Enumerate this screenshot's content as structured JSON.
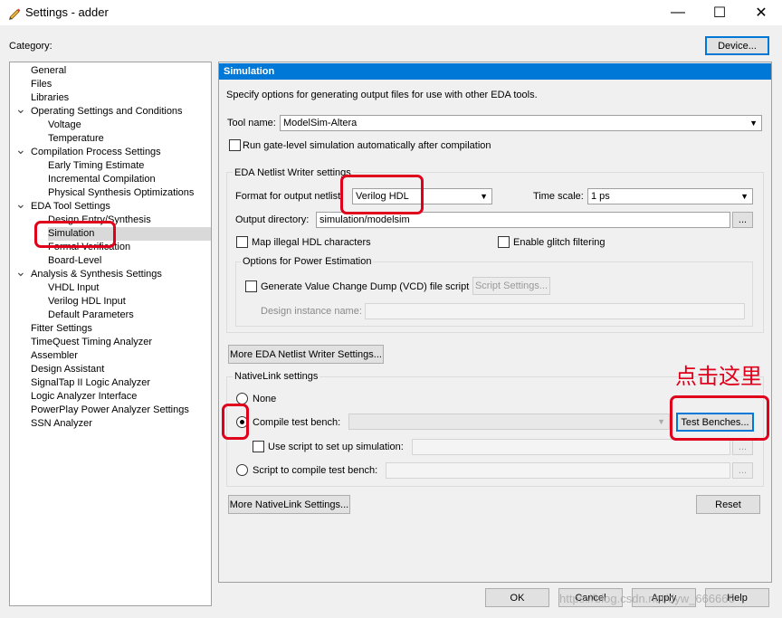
{
  "window": {
    "title": "Settings - adder",
    "icon": "pencil-icon"
  },
  "header": {
    "category_label": "Category:",
    "device_button": "Device..."
  },
  "tree": [
    {
      "label": "General",
      "level": 0
    },
    {
      "label": "Files",
      "level": 0
    },
    {
      "label": "Libraries",
      "level": 0
    },
    {
      "label": "Operating Settings and Conditions",
      "level": 0,
      "expanded": true
    },
    {
      "label": "Voltage",
      "level": 1
    },
    {
      "label": "Temperature",
      "level": 1
    },
    {
      "label": "Compilation Process Settings",
      "level": 0,
      "expanded": true
    },
    {
      "label": "Early Timing Estimate",
      "level": 1
    },
    {
      "label": "Incremental Compilation",
      "level": 1
    },
    {
      "label": "Physical Synthesis Optimizations",
      "level": 1
    },
    {
      "label": "EDA Tool Settings",
      "level": 0,
      "expanded": true
    },
    {
      "label": "Design Entry/Synthesis",
      "level": 1
    },
    {
      "label": "Simulation",
      "level": 1,
      "selected": true
    },
    {
      "label": "Formal Verification",
      "level": 1
    },
    {
      "label": "Board-Level",
      "level": 1
    },
    {
      "label": "Analysis & Synthesis Settings",
      "level": 0,
      "expanded": true
    },
    {
      "label": "VHDL Input",
      "level": 1
    },
    {
      "label": "Verilog HDL Input",
      "level": 1
    },
    {
      "label": "Default Parameters",
      "level": 1
    },
    {
      "label": "Fitter Settings",
      "level": 0
    },
    {
      "label": "TimeQuest Timing Analyzer",
      "level": 0
    },
    {
      "label": "Assembler",
      "level": 0
    },
    {
      "label": "Design Assistant",
      "level": 0
    },
    {
      "label": "SignalTap II Logic Analyzer",
      "level": 0
    },
    {
      "label": "Logic Analyzer Interface",
      "level": 0
    },
    {
      "label": "PowerPlay Power Analyzer Settings",
      "level": 0
    },
    {
      "label": "SSN Analyzer",
      "level": 0
    }
  ],
  "panel": {
    "title": "Simulation",
    "description": "Specify options for generating output files for use with other EDA tools.",
    "tool_name_label": "Tool name:",
    "tool_name_value": "ModelSim-Altera",
    "run_gate_level": "Run gate-level simulation automatically after compilation",
    "netlist_group": "EDA Netlist Writer settings",
    "format_label": "Format for output netlist:",
    "format_value": "Verilog HDL",
    "time_scale_label": "Time scale:",
    "time_scale_value": "1 ps",
    "output_dir_label": "Output directory:",
    "output_dir_value": "simulation/modelsim",
    "browse": "...",
    "map_illegal": "Map illegal HDL characters",
    "enable_glitch": "Enable glitch filtering",
    "power_group": "Options for Power Estimation",
    "generate_vcd": "Generate Value Change Dump (VCD) file script",
    "script_settings": "Script Settings...",
    "design_instance_label": "Design instance name:",
    "more_netlist": "More EDA Netlist Writer Settings...",
    "nativelink_group": "NativeLink settings",
    "none_label": "None",
    "compile_tb_label": "Compile test bench:",
    "test_benches": "Test Benches...",
    "use_script_label": "Use script to set up simulation:",
    "script_compile_label": "Script to compile test bench:",
    "more_nativelink": "More NativeLink Settings...",
    "reset": "Reset"
  },
  "footer": {
    "ok": "OK",
    "cancel": "Cancel",
    "apply": "Apply",
    "help": "Help"
  },
  "annotation": {
    "text": "点击这里",
    "color": "#e0001b"
  },
  "watermark": "https://blog.csdn.net/dyw_666666"
}
